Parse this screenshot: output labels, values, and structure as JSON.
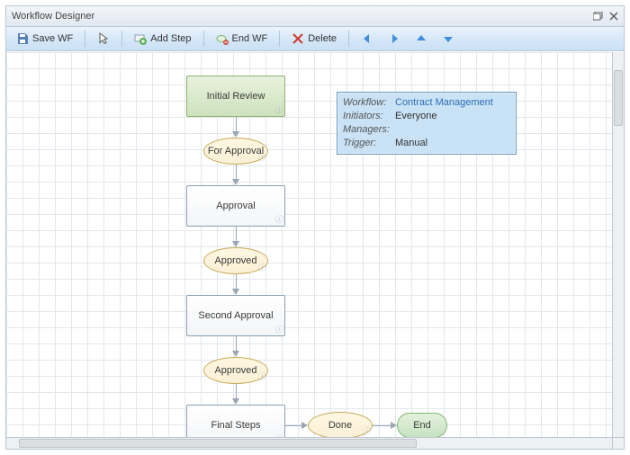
{
  "window": {
    "title": "Workflow Designer"
  },
  "toolbar": {
    "save_label": "Save WF",
    "add_step_label": "Add Step",
    "end_wf_label": "End WF",
    "delete_label": "Delete"
  },
  "workflow": {
    "steps": {
      "initial_review": "Initial Review",
      "approval": "Approval",
      "second_approval": "Second Approval",
      "final_steps": "Final Steps"
    },
    "transitions": {
      "for_approval": "For Approval",
      "approved_1": "Approved",
      "approved_2": "Approved",
      "done": "Done"
    },
    "end_label": "End"
  },
  "info": {
    "labels": {
      "workflow": "Workflow:",
      "initiators": "Initiators:",
      "managers": "Managers:",
      "trigger": "Trigger:"
    },
    "values": {
      "workflow": "Contract Management",
      "initiators": "Everyone",
      "managers": "",
      "trigger": "Manual"
    }
  }
}
